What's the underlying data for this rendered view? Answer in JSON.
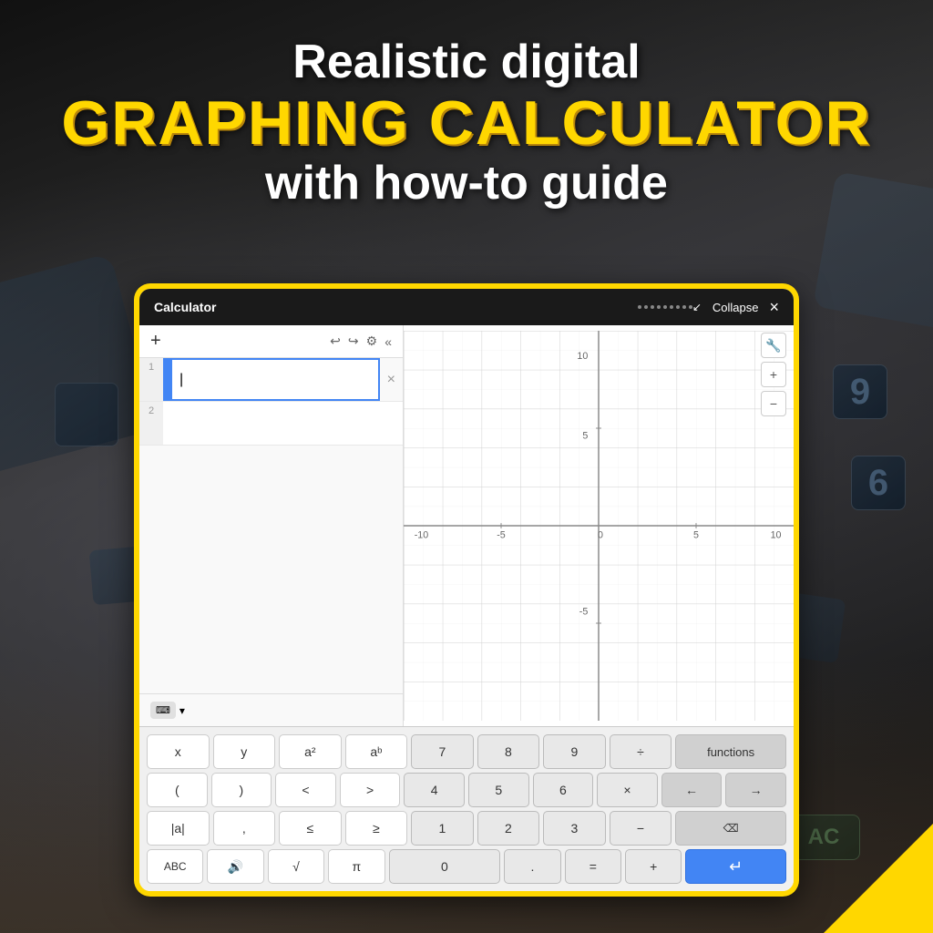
{
  "background": {
    "color": "#1a1a1a"
  },
  "header": {
    "line1": "Realistic digital",
    "line2": "GRAPHING CALCULATOR",
    "line3": "with how-to guide"
  },
  "titlebar": {
    "title": "Calculator",
    "dots_count": 9,
    "collapse_label": "Collapse",
    "close_label": "×",
    "icon_label": "↙"
  },
  "toolbar": {
    "plus": "+",
    "undo": "↩",
    "redo": "↪",
    "settings": "⚙",
    "chevron": "«"
  },
  "expressions": [
    {
      "number": "1",
      "color": "#4285f4",
      "value": "|",
      "has_delete": true
    },
    {
      "number": "2",
      "color": null,
      "value": "",
      "has_delete": false
    }
  ],
  "keyboard_toggle": {
    "icon": "⌨",
    "chevron": "▾"
  },
  "graph": {
    "x_min": -10,
    "x_max": 10,
    "y_min": -10,
    "y_max": 10,
    "x_labels": [
      "-10",
      "-5",
      "0",
      "5",
      "10"
    ],
    "y_labels": [
      "10",
      "5",
      "-5"
    ]
  },
  "graph_controls": {
    "wrench": "🔧",
    "plus": "+",
    "minus": "−"
  },
  "keyboard": {
    "rows": [
      {
        "type": "math",
        "keys": [
          {
            "label": "x",
            "type": "math"
          },
          {
            "label": "y",
            "type": "math"
          },
          {
            "label": "a²",
            "type": "math"
          },
          {
            "label": "aᵇ",
            "type": "math"
          },
          {
            "label": "7",
            "type": "num"
          },
          {
            "label": "8",
            "type": "num"
          },
          {
            "label": "9",
            "type": "num"
          },
          {
            "label": "÷",
            "type": "op"
          },
          {
            "label": "functions",
            "type": "functions"
          }
        ]
      },
      {
        "type": "math",
        "keys": [
          {
            "label": "(",
            "type": "math"
          },
          {
            "label": ")",
            "type": "math"
          },
          {
            "label": "<",
            "type": "math"
          },
          {
            "label": ">",
            "type": "math"
          },
          {
            "label": "4",
            "type": "num"
          },
          {
            "label": "5",
            "type": "num"
          },
          {
            "label": "6",
            "type": "num"
          },
          {
            "label": "×",
            "type": "op"
          },
          {
            "label": "←",
            "type": "arrow"
          },
          {
            "label": "→",
            "type": "arrow"
          }
        ]
      },
      {
        "type": "math",
        "keys": [
          {
            "label": "|a|",
            "type": "math"
          },
          {
            "label": ",",
            "type": "math"
          },
          {
            "label": "≤",
            "type": "math"
          },
          {
            "label": "≥",
            "type": "math"
          },
          {
            "label": "1",
            "type": "num"
          },
          {
            "label": "2",
            "type": "num"
          },
          {
            "label": "3",
            "type": "num"
          },
          {
            "label": "−",
            "type": "op"
          },
          {
            "label": "⌫",
            "type": "backspace"
          }
        ]
      },
      {
        "type": "math",
        "keys": [
          {
            "label": "ABC",
            "type": "math"
          },
          {
            "label": "🔊",
            "type": "math"
          },
          {
            "label": "√",
            "type": "math"
          },
          {
            "label": "π",
            "type": "math"
          },
          {
            "label": "0",
            "type": "num",
            "wide": true
          },
          {
            "label": ".",
            "type": "num"
          },
          {
            "label": "=",
            "type": "op"
          },
          {
            "label": "+",
            "type": "op"
          },
          {
            "label": "↵",
            "type": "enter"
          }
        ]
      }
    ]
  }
}
